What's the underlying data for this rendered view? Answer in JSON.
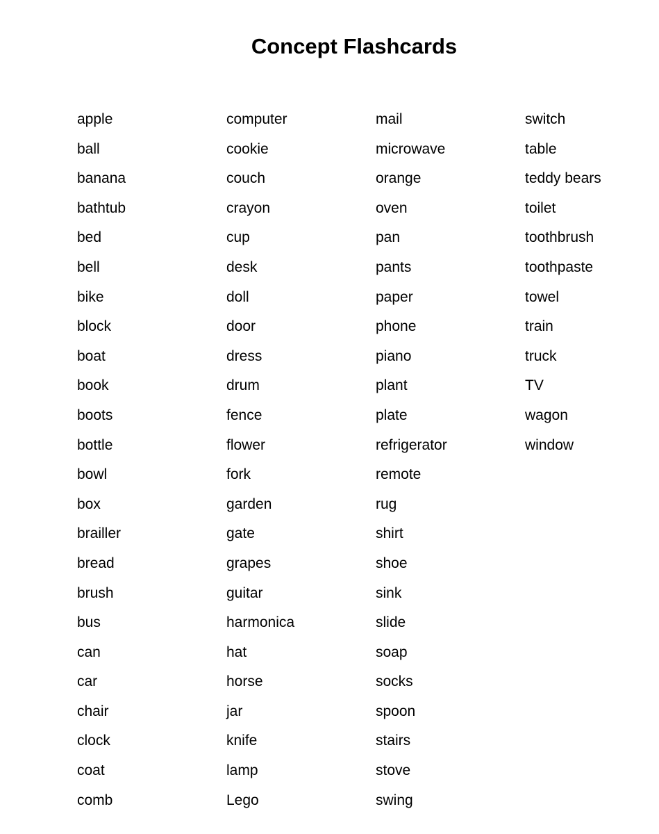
{
  "document": {
    "title": "Concept Flashcards",
    "columns": [
      [
        "apple",
        "ball",
        "banana",
        "bathtub",
        "bed",
        "bell",
        "bike",
        "block",
        "boat",
        "book",
        "boots",
        "bottle",
        "bowl",
        "box",
        "brailler",
        "bread",
        "brush",
        "bus",
        "can",
        "car",
        "chair",
        "clock",
        "coat",
        "comb"
      ],
      [
        "computer",
        "cookie",
        "couch",
        "crayon",
        "cup",
        "desk",
        "doll",
        "door",
        "dress",
        "drum",
        "fence",
        "flower",
        "fork",
        "garden",
        "gate",
        "grapes",
        "guitar",
        "harmonica",
        "hat",
        "horse",
        "jar",
        "knife",
        "lamp",
        "Lego"
      ],
      [
        "mail",
        "microwave",
        "orange",
        "oven",
        "pan",
        "pants",
        "paper",
        "phone",
        "piano",
        "plant",
        "plate",
        "refrigerator",
        "remote",
        "rug",
        "shirt",
        "shoe",
        "sink",
        "slide",
        "soap",
        "socks",
        "spoon",
        "stairs",
        "stove",
        "swing"
      ],
      [
        "switch",
        "table",
        "teddy bears",
        "toilet",
        "toothbrush",
        "toothpaste",
        "towel",
        "train",
        "truck",
        "TV",
        "wagon",
        "window"
      ]
    ]
  }
}
